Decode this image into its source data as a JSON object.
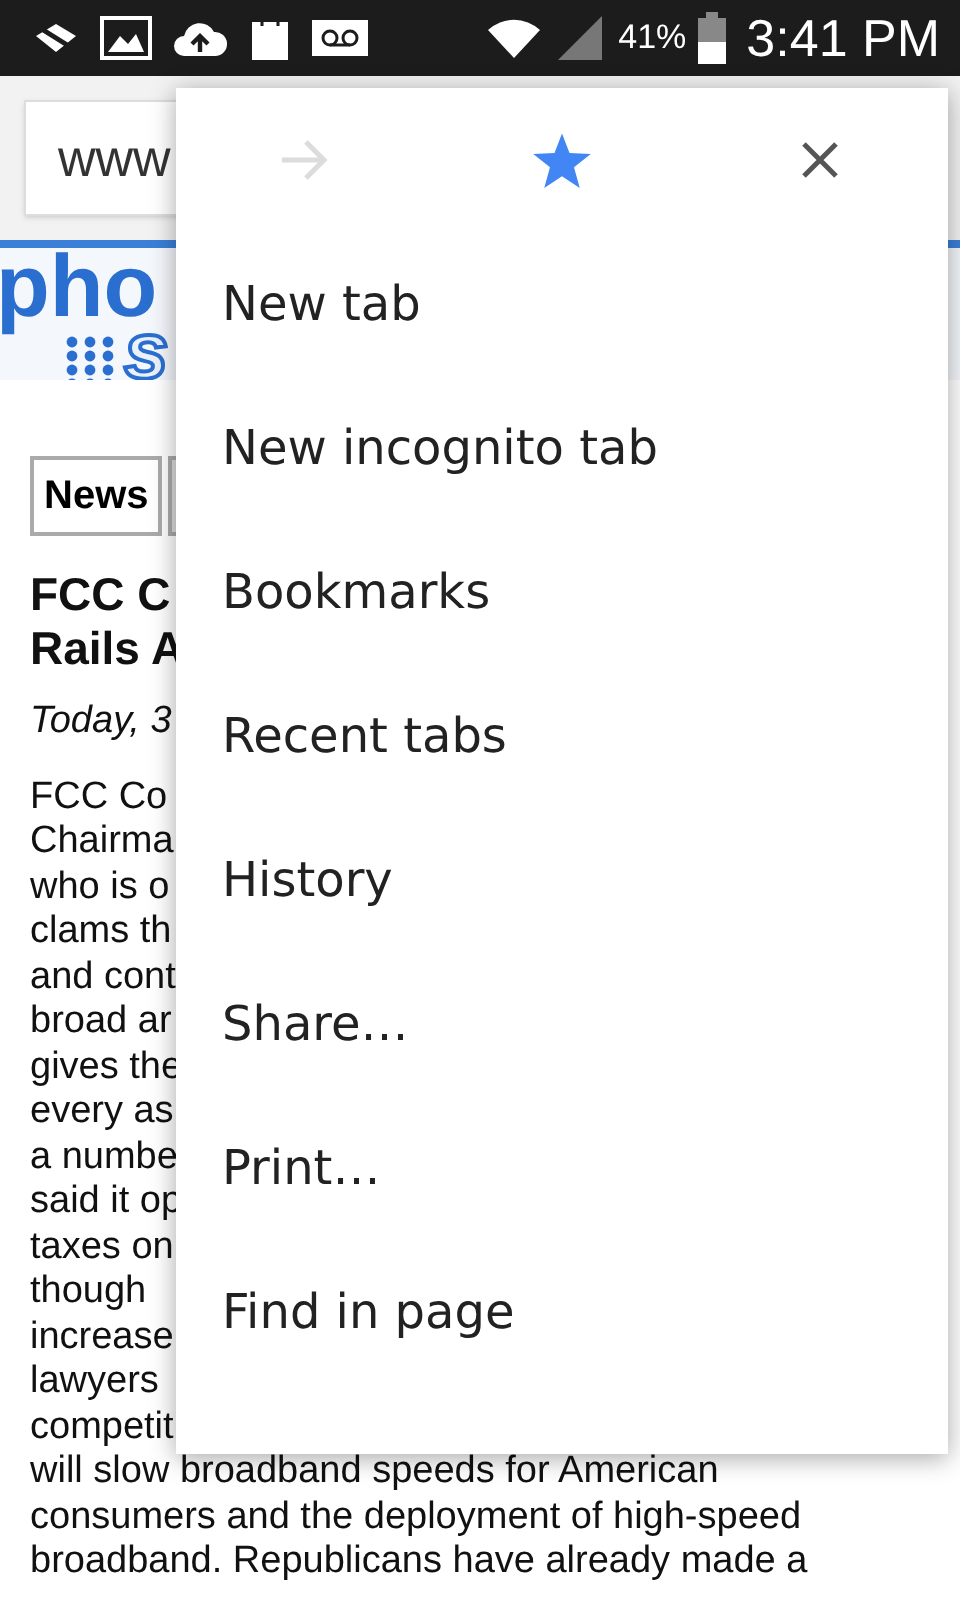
{
  "status_bar": {
    "battery": "41%",
    "time": "3:41 PM"
  },
  "address_bar": {
    "value": "www"
  },
  "site_logo": {
    "text": "pho",
    "text_2": "s"
  },
  "tabs": [
    {
      "label": "News",
      "selected": true
    }
  ],
  "article": {
    "title_lines": [
      "FCC C",
      "Rails A"
    ],
    "date": "Today, 3",
    "body_lines": [
      "FCC Co",
      "Chairma",
      "who is o",
      "clams th",
      "and cont",
      "broad ar",
      "gives the",
      "every as",
      "a numbe",
      "said it op",
      "taxes on",
      "though",
      "increase",
      "lawyers",
      "competit",
      "will slow broadband speeds for American",
      "consumers and the deployment of high-speed",
      "broadband. Republicans have already made a"
    ]
  },
  "menu": {
    "forward_disabled": true,
    "bookmarked": true,
    "items": [
      "New tab",
      "New incognito tab",
      "Bookmarks",
      "Recent tabs",
      "History",
      "Share…",
      "Print…",
      "Find in page"
    ]
  }
}
